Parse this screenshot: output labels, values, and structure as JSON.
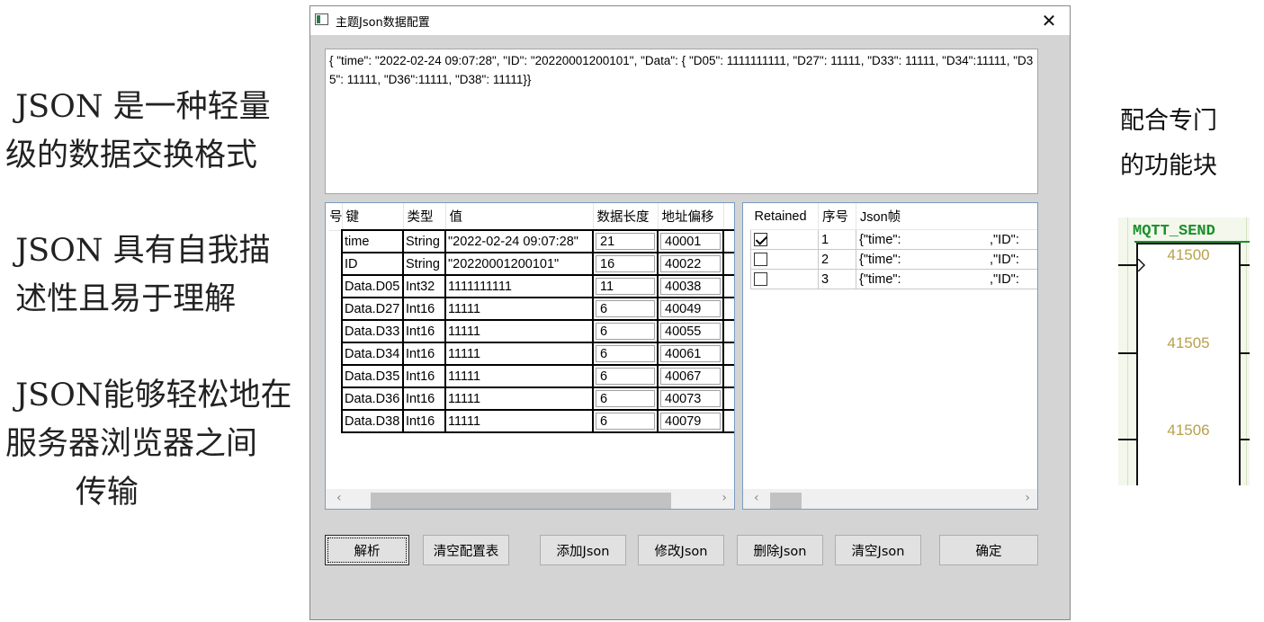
{
  "left_notes": [
    " JSON 是一种轻量\n级的数据交换格式",
    " JSON 具有自我描\n 述性且易于理解",
    " JSON能够轻松地在\n服务器浏览器之间\n       传输"
  ],
  "right_note": [
    "配合专门",
    "的功能块"
  ],
  "dialog": {
    "title": "主题Json数据配置",
    "close_glyph": "✕",
    "json_text": "{ \"time\": \"2022-02-24 09:07:28\", \"ID\": \"20220001200101\", \"Data\": { \"D05\": 1111111111,  \"D27\": 11111,  \"D33\": 11111,   \"D34\":11111,  \"D35\": 11111,   \"D36\":11111,  \"D38\": 11111}}"
  },
  "config_table": {
    "row_header_label": "号",
    "columns": [
      "键",
      "类型",
      "值",
      "数据长度",
      "地址偏移"
    ],
    "rows": [
      [
        "time",
        "String",
        "\"2022-02-24 09:07:28\"",
        "21",
        "40001"
      ],
      [
        "ID",
        "String",
        "\"20220001200101\"",
        "16",
        "40022"
      ],
      [
        "Data.D05",
        "Int32",
        "1111111111",
        "11",
        "40038"
      ],
      [
        "Data.D27",
        "Int16",
        "11111",
        "6",
        "40049"
      ],
      [
        "Data.D33",
        "Int16",
        "11111",
        "6",
        "40055"
      ],
      [
        "Data.D34",
        "Int16",
        "11111",
        "6",
        "40061"
      ],
      [
        "Data.D35",
        "Int16",
        "11111",
        "6",
        "40067"
      ],
      [
        "Data.D36",
        "Int16",
        "11111",
        "6",
        "40073"
      ],
      [
        "Data.D38",
        "Int16",
        "11111",
        "6",
        "40079"
      ]
    ]
  },
  "json_list": {
    "columns": [
      "Retained",
      "序号",
      "Json帧"
    ],
    "rows": [
      {
        "retained": true,
        "index": "1",
        "frame": "{\"time\":",
        "frame_tail": ",\"ID\":"
      },
      {
        "retained": false,
        "index": "2",
        "frame": "{\"time\":",
        "frame_tail": ",\"ID\":"
      },
      {
        "retained": false,
        "index": "3",
        "frame": "{\"time\":",
        "frame_tail": ",\"ID\":"
      }
    ]
  },
  "scroll": {
    "left_arrow": "‹",
    "right_arrow": "›"
  },
  "buttons": {
    "parse": "解析",
    "clear_config": "清空配置表",
    "add_json": "添加Json",
    "edit_json": "修改Json",
    "delete_json": "删除Json",
    "clear_json": "清空Json",
    "ok": "确定"
  },
  "mqtt_block": {
    "title": "MQTT_SEND",
    "values": [
      "41500",
      "41505",
      "41506"
    ]
  }
}
